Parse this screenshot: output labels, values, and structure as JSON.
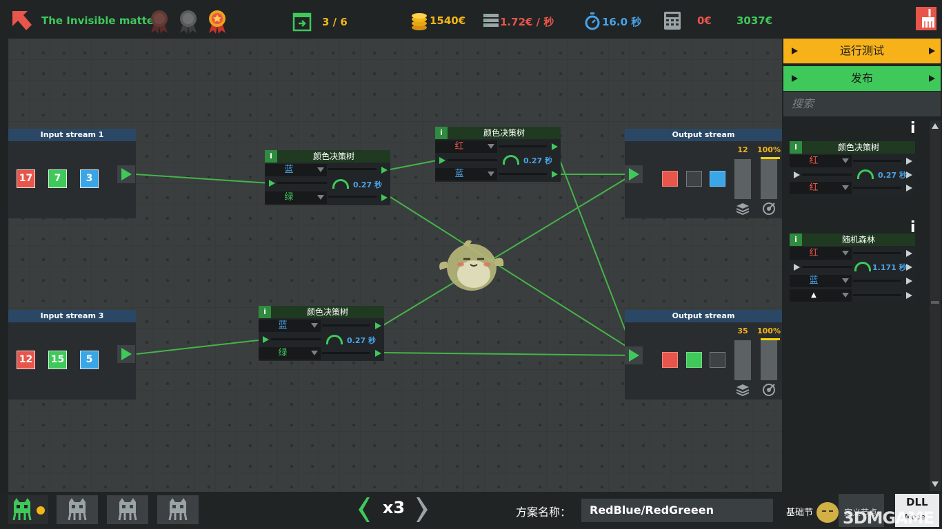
{
  "topbar": {
    "level_title": "The Invisible matter",
    "progress": "3 / 6",
    "coins": "1540€",
    "rate": "1.72€ / 秒",
    "time": "16.0 秒",
    "cost": "0€",
    "total": "3037€",
    "icons": [
      "back-arrow-icon",
      "medal-bronze-icon",
      "medal-silver-icon",
      "medal-gold-icon",
      "exit-level-icon",
      "coins-icon",
      "server-icon",
      "stopwatch-icon",
      "calculator-icon",
      "clean-broom-icon"
    ]
  },
  "colors": {
    "red": "#e8554a",
    "green": "#3fc95a",
    "blue": "#3aa6e8",
    "accent_yellow": "#f7b21a",
    "accent_green": "#3fc95a"
  },
  "nodes": {
    "input1": {
      "title": "Input stream 1",
      "values": [
        "17",
        "7",
        "3"
      ]
    },
    "input3": {
      "title": "Input stream 3",
      "values": [
        "12",
        "15",
        "5"
      ]
    },
    "tree1": {
      "title": "颜色决策树",
      "info": "i",
      "slot1": "蓝",
      "slot2": "绿",
      "speed": "0.27 秒"
    },
    "tree2": {
      "title": "颜色决策树",
      "info": "i",
      "slot1": "红",
      "slot2": "蓝",
      "speed": "0.27 秒"
    },
    "tree3": {
      "title": "颜色决策树",
      "info": "i",
      "slot1": "蓝",
      "slot2": "绿",
      "speed": "0.27 秒"
    },
    "output1": {
      "title": "Output stream",
      "count": "12",
      "percent": "100%"
    },
    "output2": {
      "title": "Output stream",
      "count": "35",
      "percent": "100%"
    }
  },
  "sidebar": {
    "run_test": "运行测试",
    "publish": "发布",
    "search_placeholder": "搜索",
    "info": "i",
    "items": [
      {
        "title": "颜色决策树",
        "info": "i",
        "slot1": "红",
        "slot2": "红",
        "speed": "0.27 秒"
      },
      {
        "title": "随机森林",
        "info": "i",
        "slot1": "红",
        "slot2": "蓝",
        "slot3": "▲",
        "speed": "1.171 秒"
      }
    ]
  },
  "bottombar": {
    "speed_multiplier": "x3",
    "scheme_label": "方案名称：",
    "scheme_name": "RedBlue/RedGreeen",
    "tab_basic": "基础节",
    "tab_custom": "定义节点",
    "dll_label": "DLL",
    "dll_sub": "Mode",
    "watermark": "3DMGAME"
  }
}
